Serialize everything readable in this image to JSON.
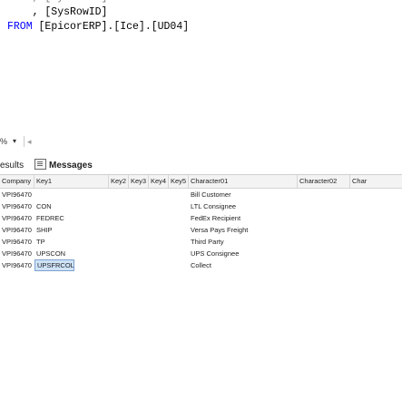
{
  "editor": {
    "line1": "    , [SysRowID]",
    "line2": "FROM",
    "line2_rest": " [EpicorERP].[Ice].[UD04]"
  },
  "zoom": {
    "value": "%",
    "arrow": "▾",
    "scroll_left": "◂"
  },
  "tabs": {
    "results": "esults",
    "messages": "Messages"
  },
  "grid": {
    "columns": [
      "Company",
      "Key1",
      "Key2",
      "Key3",
      "Key4",
      "Key5",
      "Character01",
      "Character02",
      "Char"
    ],
    "rows": [
      [
        "VPI96470",
        "",
        "",
        "",
        "",
        "",
        "Bill Customer",
        "",
        ""
      ],
      [
        "VPI96470",
        "CON",
        "",
        "",
        "",
        "",
        "LTL Consignee",
        "",
        ""
      ],
      [
        "VPI96470",
        "FEDREC",
        "",
        "",
        "",
        "",
        "FedEx Recipient",
        "",
        ""
      ],
      [
        "VPI96470",
        "SHIP",
        "",
        "",
        "",
        "",
        "Versa Pays Freight",
        "",
        ""
      ],
      [
        "VPI96470",
        "TP",
        "",
        "",
        "",
        "",
        "Third Party",
        "",
        ""
      ],
      [
        "VPI96470",
        "UPSCON",
        "",
        "",
        "",
        "",
        "UPS Consignee",
        "",
        ""
      ],
      [
        "VPI96470",
        "UPSFRCOL",
        "",
        "",
        "",
        "",
        "Collect",
        "",
        ""
      ]
    ]
  }
}
